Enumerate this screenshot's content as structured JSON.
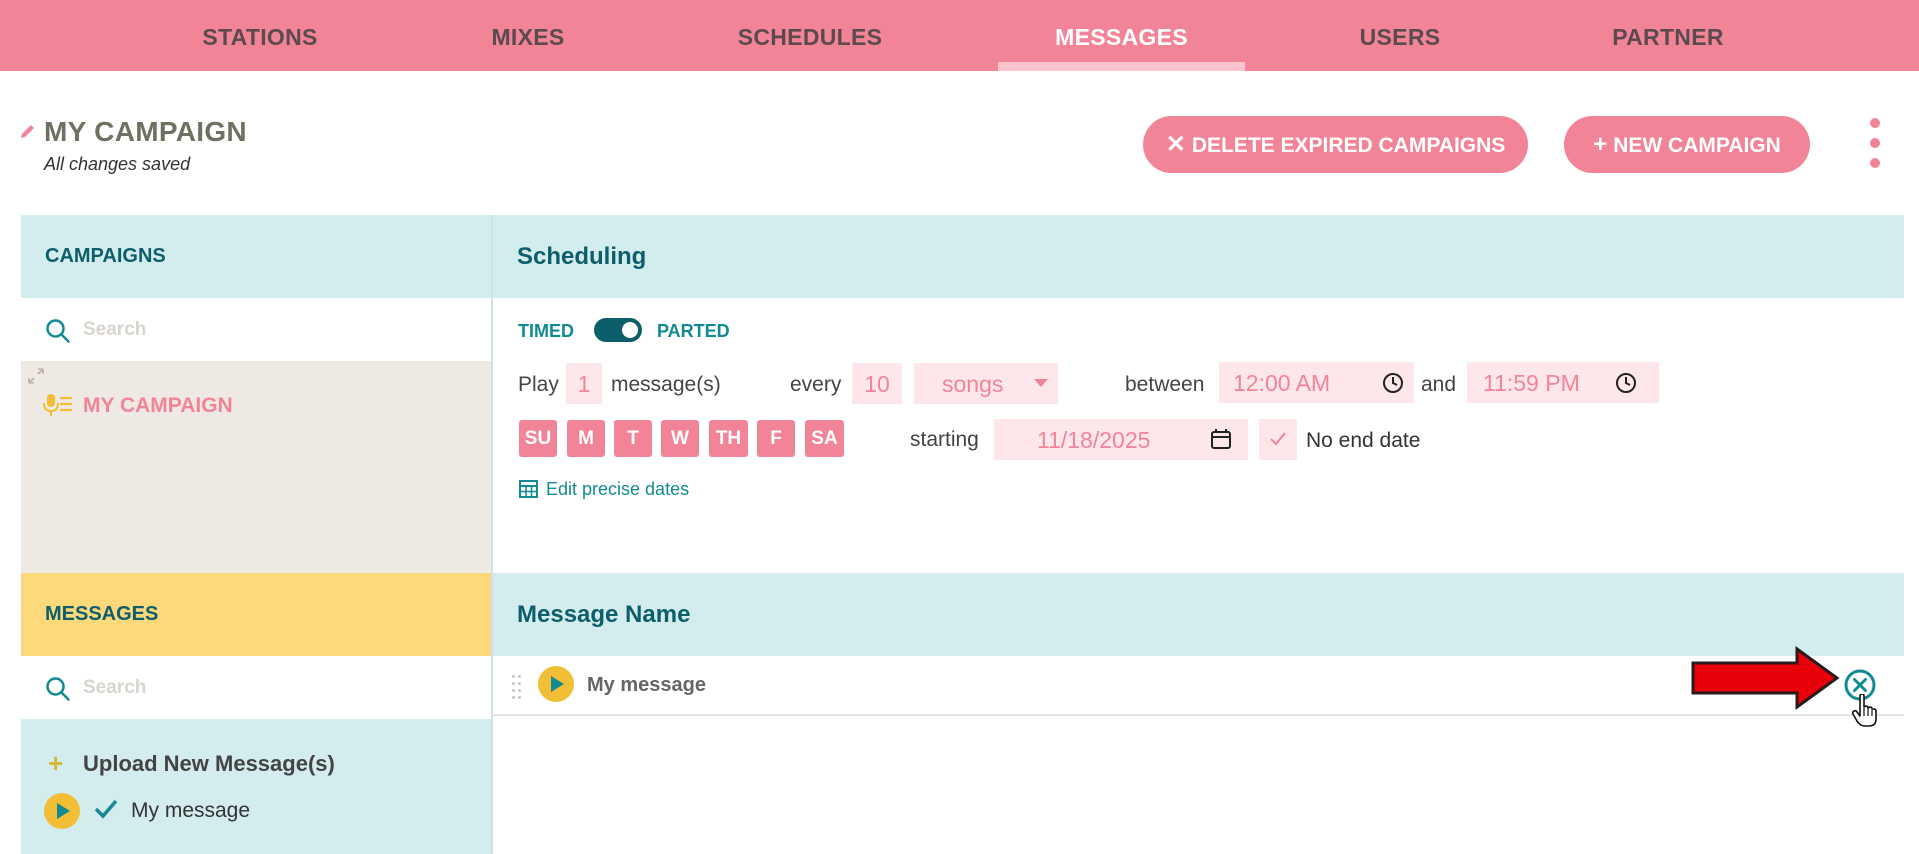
{
  "nav": {
    "tabs": [
      "STATIONS",
      "MIXES",
      "SCHEDULES",
      "MESSAGES",
      "USERS",
      "PARTNER"
    ],
    "active_tab": "MESSAGES"
  },
  "header": {
    "campaign_title": "MY CAMPAIGN",
    "save_status": "All changes saved",
    "delete_expired_label": "DELETE EXPIRED CAMPAIGNS",
    "new_campaign_label": "NEW CAMPAIGN"
  },
  "campaigns_panel": {
    "title": "CAMPAIGNS",
    "search_placeholder": "Search",
    "items": [
      "MY CAMPAIGN"
    ]
  },
  "scheduling": {
    "title": "Scheduling",
    "mode_left": "TIMED",
    "mode_right": "PARTED",
    "play_label": "Play",
    "play_count": "1",
    "messages_label": "message(s)",
    "every_label": "every",
    "every_count": "10",
    "unit": "songs",
    "between_label": "between",
    "start_time": "12:00 AM",
    "and_label": "and",
    "end_time": "11:59 PM",
    "days": [
      "SU",
      "M",
      "T",
      "W",
      "TH",
      "F",
      "SA"
    ],
    "starting_label": "starting",
    "start_date": "11/18/2025",
    "no_end_date_label": "No end date",
    "edit_dates_label": "Edit precise dates"
  },
  "messages_panel": {
    "title": "MESSAGES",
    "search_placeholder": "Search",
    "upload_label": "Upload New Message(s)",
    "library": [
      "My message"
    ]
  },
  "message_list": {
    "column_header": "Message Name",
    "rows": [
      "My message"
    ]
  },
  "colors": {
    "brand_pink": "#f28497",
    "teal_dark": "#0d5e6b",
    "teal": "#118a94",
    "panel_blue": "#d3ecee",
    "messages_yellow": "#fdd97c",
    "annotation_arrow": "#e8000b"
  },
  "icons": [
    "pencil-icon",
    "close-icon",
    "plus-icon",
    "kebab-icon",
    "search-icon",
    "expand-icon",
    "campaign-icon",
    "chevron-down-icon",
    "clock-icon",
    "calendar-icon",
    "check-icon",
    "grid-calendar-icon",
    "drag-handle-icon",
    "play-icon",
    "remove-icon",
    "arrow-annotation",
    "hand-cursor-icon"
  ]
}
